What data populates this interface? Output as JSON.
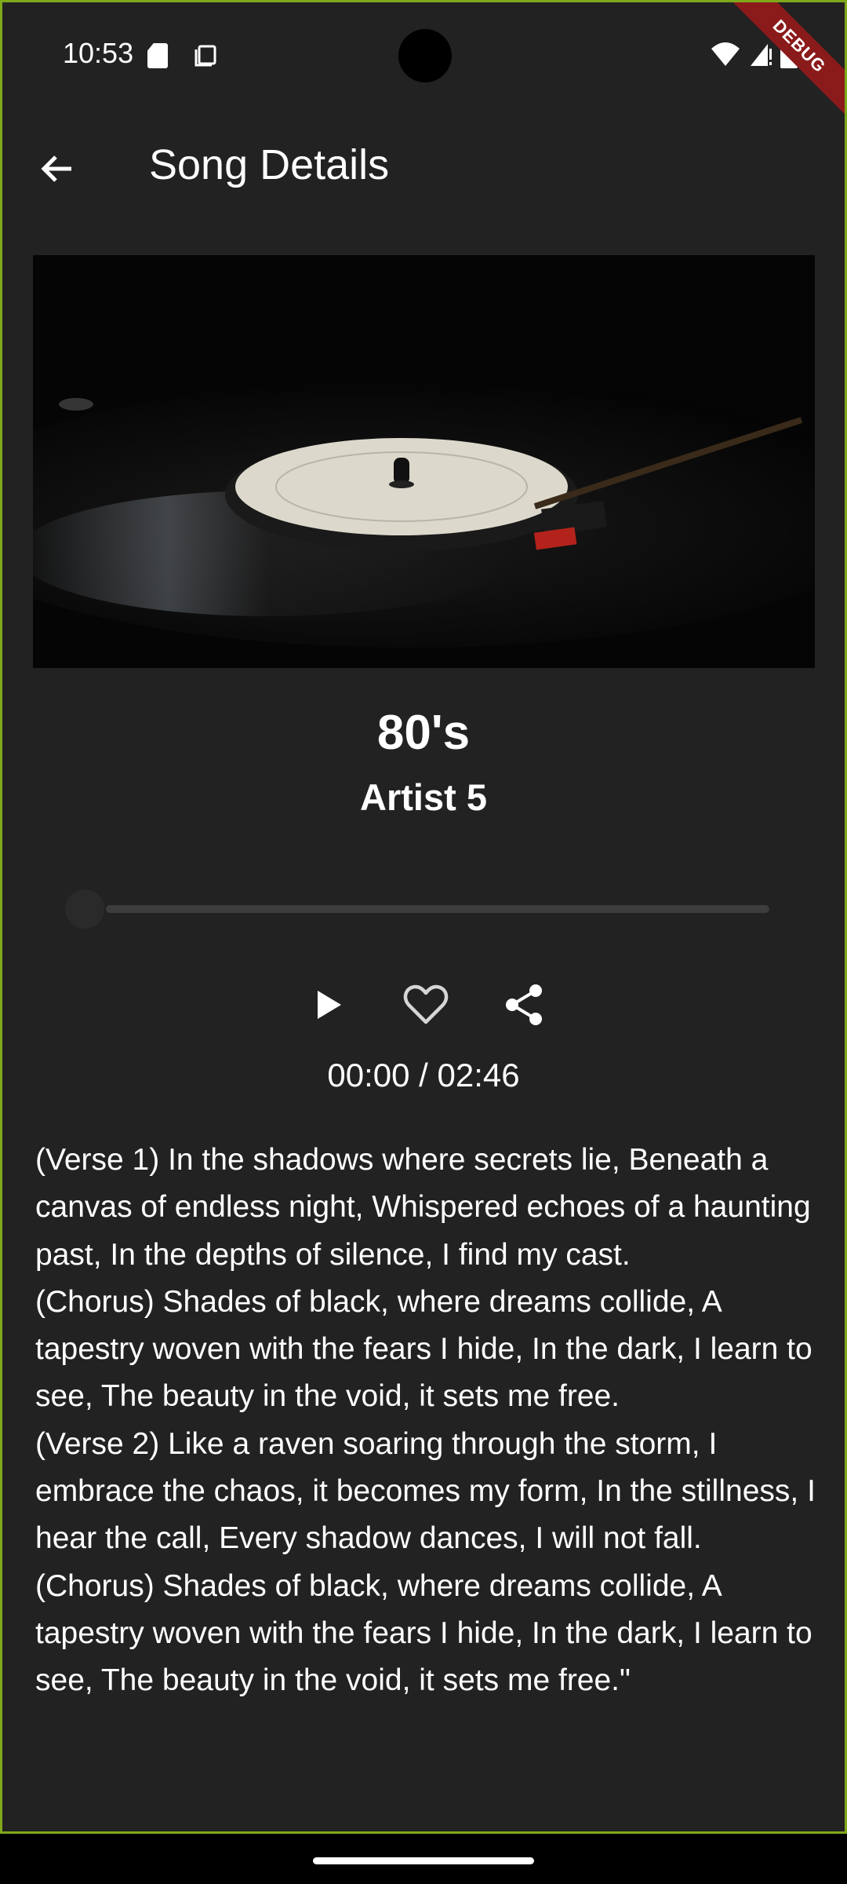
{
  "status_bar": {
    "time": "10:53",
    "debug_label": "DEBUG"
  },
  "app_bar": {
    "title": "Song Details"
  },
  "song": {
    "title": "80's",
    "artist": "Artist 5",
    "progress_fraction": 0.0,
    "time_display": "00:00 / 02:46",
    "lyrics": "(Verse 1) In the shadows where secrets lie, Beneath a canvas of endless night, Whispered echoes of a haunting past, In the depths of silence, I find my cast.\n(Chorus) Shades of black, where dreams collide, A tapestry woven with the fears I hide, In the dark, I learn to see, The beauty in the void, it sets me free.\n(Verse 2) Like a raven soaring through the storm, I embrace the chaos, it becomes my form, In the stillness, I hear the call, Every shadow dances, I will not fall.\n(Chorus) Shades of black, where dreams collide, A tapestry woven with the fears I hide, In the dark, I learn to see, The beauty in the void, it sets me free.\""
  },
  "icons": {
    "back": "arrow-back-icon",
    "play": "play-icon",
    "like": "heart-outline-icon",
    "share": "share-icon"
  },
  "colors": {
    "background": "#222222",
    "frame_border": "#7fa81a",
    "debug_ribbon": "#8b1a1a",
    "slider_track": "#3d3d3d"
  }
}
